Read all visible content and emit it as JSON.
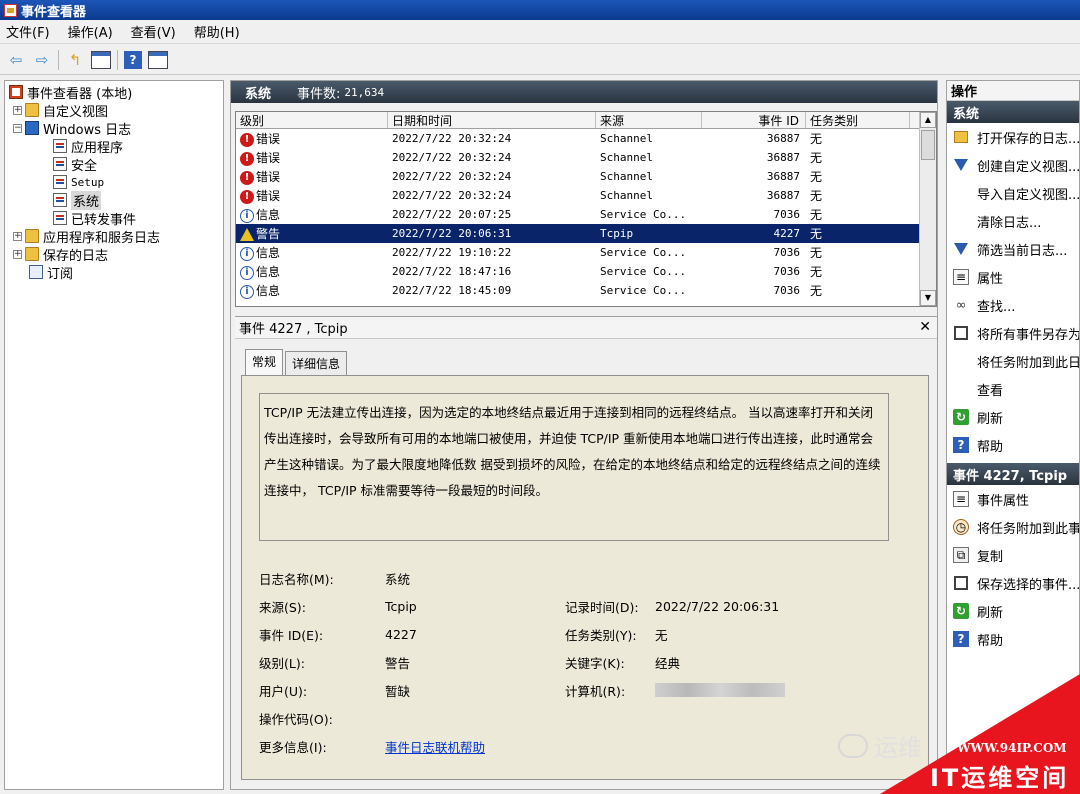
{
  "window": {
    "title": "事件查看器"
  },
  "menu": [
    "文件(F)",
    "操作(A)",
    "查看(V)",
    "帮助(H)"
  ],
  "tree": {
    "root": "事件查看器 (本地)",
    "custom_views": "自定义视图",
    "windows_logs": "Windows 日志",
    "application": "应用程序",
    "security": "安全",
    "setup": "Setup",
    "system": "系统",
    "forwarded": "已转发事件",
    "app_services": "应用程序和服务日志",
    "saved_logs": "保存的日志",
    "subscriptions": "订阅"
  },
  "middle": {
    "title": "系统",
    "event_count_label": "事件数:",
    "event_count": "21,634",
    "columns": {
      "level": "级别",
      "datetime": "日期和时间",
      "source": "来源",
      "event_id": "事件 ID",
      "task": "任务类别"
    },
    "rows": [
      {
        "level": "错误",
        "type": "error",
        "datetime": "2022/7/22 20:32:24",
        "source": "Schannel",
        "event_id": "36887",
        "task": "无"
      },
      {
        "level": "错误",
        "type": "error",
        "datetime": "2022/7/22 20:32:24",
        "source": "Schannel",
        "event_id": "36887",
        "task": "无"
      },
      {
        "level": "错误",
        "type": "error",
        "datetime": "2022/7/22 20:32:24",
        "source": "Schannel",
        "event_id": "36887",
        "task": "无"
      },
      {
        "level": "错误",
        "type": "error",
        "datetime": "2022/7/22 20:32:24",
        "source": "Schannel",
        "event_id": "36887",
        "task": "无"
      },
      {
        "level": "信息",
        "type": "info",
        "datetime": "2022/7/22 20:07:25",
        "source": "Service Co...",
        "event_id": "7036",
        "task": "无"
      },
      {
        "level": "警告",
        "type": "warning",
        "datetime": "2022/7/22 20:06:31",
        "source": "Tcpip",
        "event_id": "4227",
        "task": "无",
        "selected": true
      },
      {
        "level": "信息",
        "type": "info",
        "datetime": "2022/7/22 19:10:22",
        "source": "Service Co...",
        "event_id": "7036",
        "task": "无"
      },
      {
        "level": "信息",
        "type": "info",
        "datetime": "2022/7/22 18:47:16",
        "source": "Service Co...",
        "event_id": "7036",
        "task": "无"
      },
      {
        "level": "信息",
        "type": "info",
        "datetime": "2022/7/22 18:45:09",
        "source": "Service Co...",
        "event_id": "7036",
        "task": "无"
      }
    ]
  },
  "detail": {
    "title": "事件 4227 , Tcpip",
    "tab_general": "常规",
    "tab_details": "详细信息",
    "description": "TCP/IP 无法建立传出连接，因为选定的本地终结点最近用于连接到相同的远程终结点。 当以高速率打开和关闭传出连接时，会导致所有可用的本地端口被使用，并迫使 TCP/IP  重新使用本地端口进行传出连接，此时通常会产生这种错误。为了最大限度地降低数 据受到损坏的风险，在给定的本地终结点和给定的远程终结点之间的连续连接中， TCP/IP 标准需要等待一段最短的时间段。",
    "fields": {
      "log_name_label": "日志名称(M):",
      "log_name": "系统",
      "source_label": "来源(S):",
      "source": "Tcpip",
      "logged_label": "记录时间(D):",
      "logged": "2022/7/22 20:06:31",
      "event_id_label": "事件 ID(E):",
      "event_id": "4227",
      "task_label": "任务类别(Y):",
      "task": "无",
      "level_label": "级别(L):",
      "level": "警告",
      "keywords_label": "关键字(K):",
      "keywords": "经典",
      "user_label": "用户(U):",
      "user": "暂缺",
      "computer_label": "计算机(R):",
      "opcode_label": "操作代码(O):",
      "more_info_label": "更多信息(I):",
      "more_info_link": "事件日志联机帮助"
    }
  },
  "actions": {
    "header": "操作",
    "section_system": "系统",
    "system_items": [
      {
        "label": "打开保存的日志...",
        "icon": "folder-icon"
      },
      {
        "label": "创建自定义视图...",
        "icon": "filter-icon"
      },
      {
        "label": "导入自定义视图...",
        "icon": "none"
      },
      {
        "label": "清除日志...",
        "icon": "none"
      },
      {
        "label": "筛选当前日志...",
        "icon": "filter-icon"
      },
      {
        "label": "属性",
        "icon": "properties-icon"
      },
      {
        "label": "查找...",
        "icon": "binoculars-icon"
      },
      {
        "label": "将所有事件另存为...",
        "icon": "save-icon"
      },
      {
        "label": "将任务附加到此日志...",
        "icon": "none"
      },
      {
        "label": "查看",
        "icon": "none"
      },
      {
        "label": "刷新",
        "icon": "refresh-icon"
      },
      {
        "label": "帮助",
        "icon": "help-icon"
      }
    ],
    "section_event": "事件 4227, Tcpip",
    "event_items": [
      {
        "label": "事件属性",
        "icon": "properties-icon"
      },
      {
        "label": "将任务附加到此事件...",
        "icon": "task-icon"
      },
      {
        "label": "复制",
        "icon": "copy-icon"
      },
      {
        "label": "保存选择的事件...",
        "icon": "save-icon"
      },
      {
        "label": "刷新",
        "icon": "refresh-icon"
      },
      {
        "label": "帮助",
        "icon": "help-icon"
      }
    ]
  },
  "watermark": {
    "wechat": "运维",
    "url": "WWW.94IP.COM",
    "brand": "IT运维空间"
  }
}
